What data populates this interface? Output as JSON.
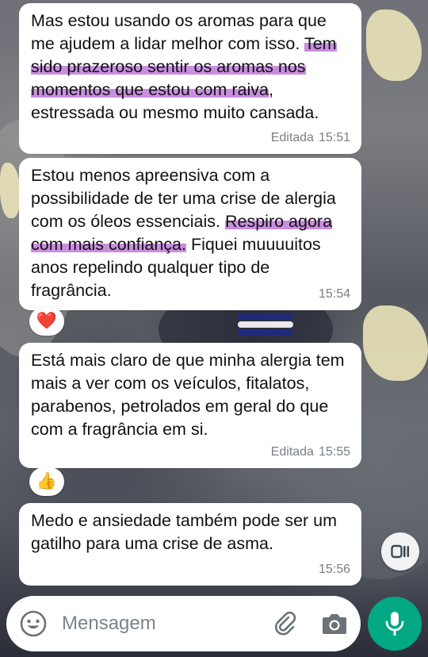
{
  "messages": [
    {
      "before": "Mas estou usando os aromas para que me ajudem a lidar melhor com isso. ",
      "highlight": "Tem sido prazeroso sentir os aromas nos momentos que estou com raiva",
      "after": ", estressada ou mesmo muito cansada.",
      "edited_label": "Editada",
      "time": "15:51"
    },
    {
      "before": "Estou menos apreensiva com a possibilidade de ter uma crise de alergia com os óleos essenciais. ",
      "highlight": "Respiro agora com mais confiança.",
      "after": " Fiquei muuuuitos anos repelindo qualquer tipo de fragrância.",
      "time": "15:54",
      "reaction": "❤️"
    },
    {
      "text": "Está mais claro de que minha alergia tem mais a ver com os veículos, fitalatos, parabenos, petrolados em geral do que com a fragrância em si.",
      "edited_label": "Editada",
      "time": "15:55",
      "reaction": "👍"
    },
    {
      "text": "Medo e ansiedade também pode ser um gatilho para uma crise de asma.",
      "time": "15:56"
    }
  ],
  "composer": {
    "placeholder": "Mensagem"
  },
  "colors": {
    "bubble": "#ffffff",
    "highlight": "#c98ee0",
    "mic_button": "#00a884",
    "meta_text": "#7a7f83"
  },
  "icons": {
    "emoji": "emoji-icon",
    "attach": "paperclip-icon",
    "camera": "camera-icon",
    "mic": "mic-icon",
    "view_once": "view-once-icon"
  }
}
